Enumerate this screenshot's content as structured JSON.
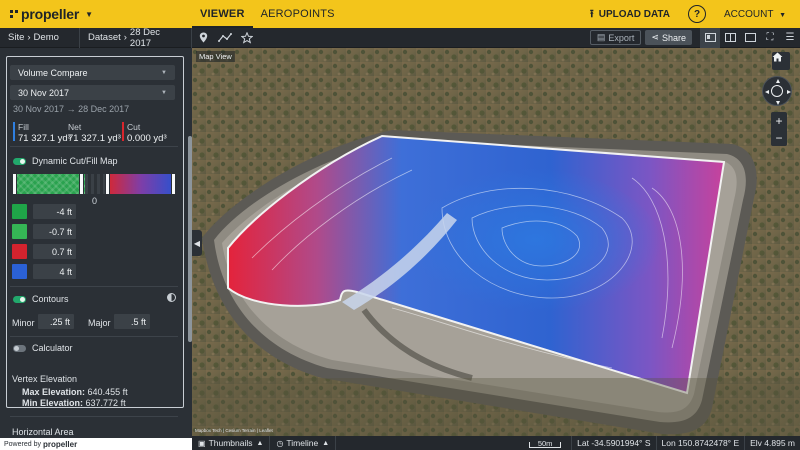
{
  "app": {
    "brand": "propeller",
    "footer_prefix": "Powered by",
    "footer_brand": "propeller"
  },
  "nav": {
    "tabs": [
      {
        "label": "VIEWER",
        "active": true
      },
      {
        "label": "AEROPOINTS",
        "active": false
      }
    ],
    "upload_label": "UPLOAD DATA",
    "help_label": "?",
    "account_label": "ACCOUNT"
  },
  "subbar": {
    "site_crumb": [
      "Site",
      "Demo"
    ],
    "dataset_crumb": [
      "Dataset",
      "28 Dec 2017"
    ],
    "export_label": "Export",
    "share_label": "Share"
  },
  "sidebar": {
    "compare_mode": "Volume Compare",
    "compare_date": "30 Nov 2017",
    "date_range_from": "30 Nov 2017",
    "date_range_arrow": "→",
    "date_range_to": "28 Dec 2017",
    "stats": [
      {
        "label": "Fill",
        "value": "71 327.1 yd³",
        "color": "#2f7fe0"
      },
      {
        "label": "Net",
        "value": "71 327.1 yd³",
        "color": "#2b3036"
      },
      {
        "label": "Cut",
        "value": "0.000 yd³",
        "color": "#d9262d"
      }
    ],
    "dynamic_map_label": "Dynamic Cut/Fill Map",
    "dynamic_map_on": true,
    "colormap_zero": "0",
    "thresholds": [
      {
        "value": "-4",
        "unit": "ft",
        "color": "#1fa548"
      },
      {
        "value": "-0.7",
        "unit": "ft",
        "color": "#35b655"
      },
      {
        "value": "0.7",
        "unit": "ft",
        "color": "#d4232e"
      },
      {
        "value": "4",
        "unit": "ft",
        "color": "#2b61d6"
      }
    ],
    "contours_label": "Contours",
    "contours_on": true,
    "minor_label": "Minor",
    "minor_value": ".25 ft",
    "major_label": "Major",
    "major_value": ".5 ft",
    "calculator_label": "Calculator",
    "calculator_on": false,
    "vertex_title": "Vertex Elevation",
    "max_label": "Max Elevation:",
    "max_value": "640.455 ft",
    "min_label": "Min Elevation:",
    "min_value": "637.772 ft",
    "horizontal_title": "Horizontal Area"
  },
  "map": {
    "view_label": "Map View",
    "attribution": "Mapbox Tech | Cesium Terrain | Leaflet"
  },
  "bottom": {
    "thumbnails_label": "Thumbnails",
    "timeline_label": "Timeline",
    "scale_label": "50m",
    "lat": "Lat -34.5901994° S",
    "lon": "Lon 150.8742478° E",
    "elv": "Elv 4.895 m"
  },
  "colors": {
    "accent": "#f3c51b",
    "panel": "#2b3036",
    "fill": "#2f7fe0",
    "cut": "#d9262d",
    "toggle_on": "#22a86c"
  },
  "icons": [
    "pin-icon",
    "line-measure-icon",
    "star-icon",
    "upload-icon",
    "help-icon",
    "chevron-down-icon",
    "home-icon",
    "compass-icon",
    "plus-icon",
    "minus-icon",
    "image-icon",
    "clock-icon",
    "contrast-icon",
    "settings-icon",
    "fullscreen-icon"
  ]
}
